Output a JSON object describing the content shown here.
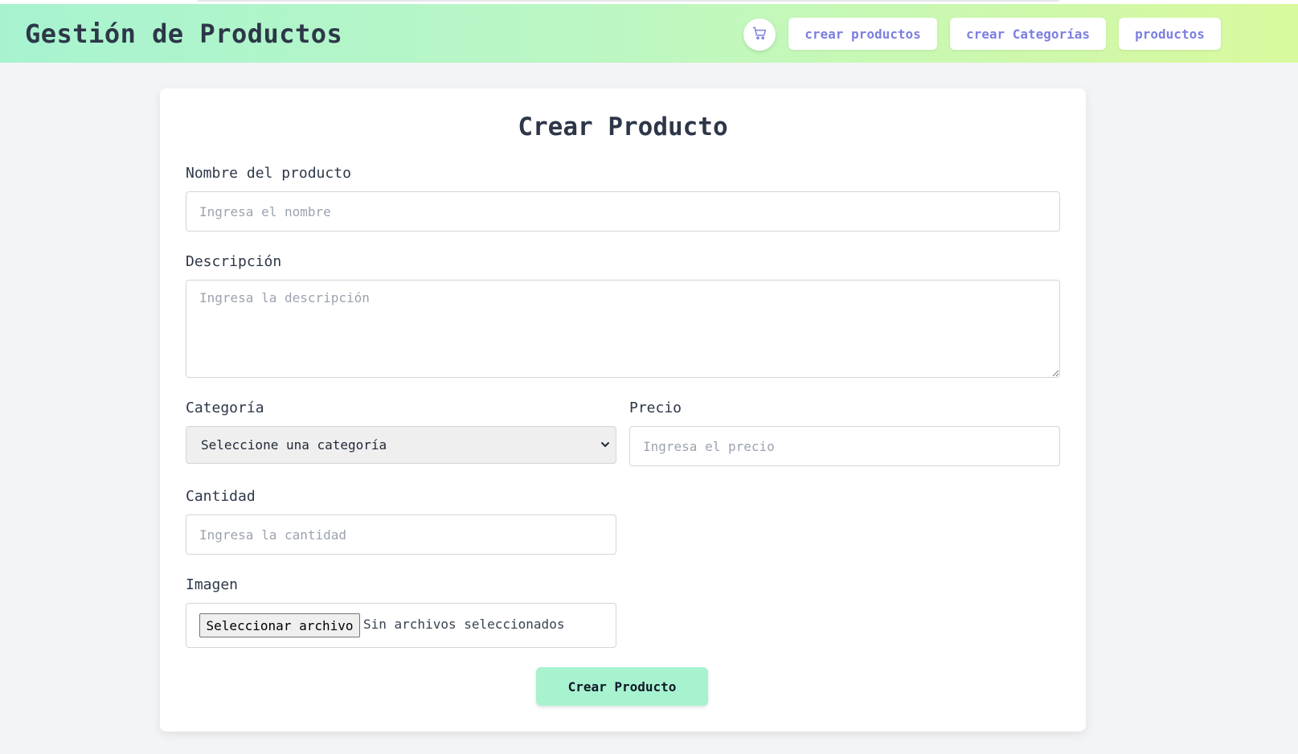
{
  "header": {
    "brand": "Gestión de Productos",
    "cart_icon": "shopping-cart-icon",
    "nav": [
      {
        "label": "crear productos"
      },
      {
        "label": "crear Categorías"
      },
      {
        "label": "productos"
      }
    ],
    "gradient_colors": [
      "#a7f3d0",
      "#d9f99d"
    ],
    "nav_text_color": "#7c7fe0"
  },
  "form": {
    "title": "Crear Producto",
    "name": {
      "label": "Nombre del producto",
      "placeholder": "Ingresa el nombre",
      "value": ""
    },
    "description": {
      "label": "Descripción",
      "placeholder": "Ingresa la descripción",
      "value": ""
    },
    "category": {
      "label": "Categoría",
      "selected": "Seleccione una categoría"
    },
    "price": {
      "label": "Precio",
      "placeholder": "Ingresa el precio",
      "value": ""
    },
    "quantity": {
      "label": "Cantidad",
      "placeholder": "Ingresa la cantidad",
      "value": ""
    },
    "image": {
      "label": "Imagen",
      "button": "Seleccionar archivo",
      "status": "Sin archivos seleccionados"
    },
    "submit": "Crear Producto",
    "submit_color": "#a7f3d0"
  }
}
